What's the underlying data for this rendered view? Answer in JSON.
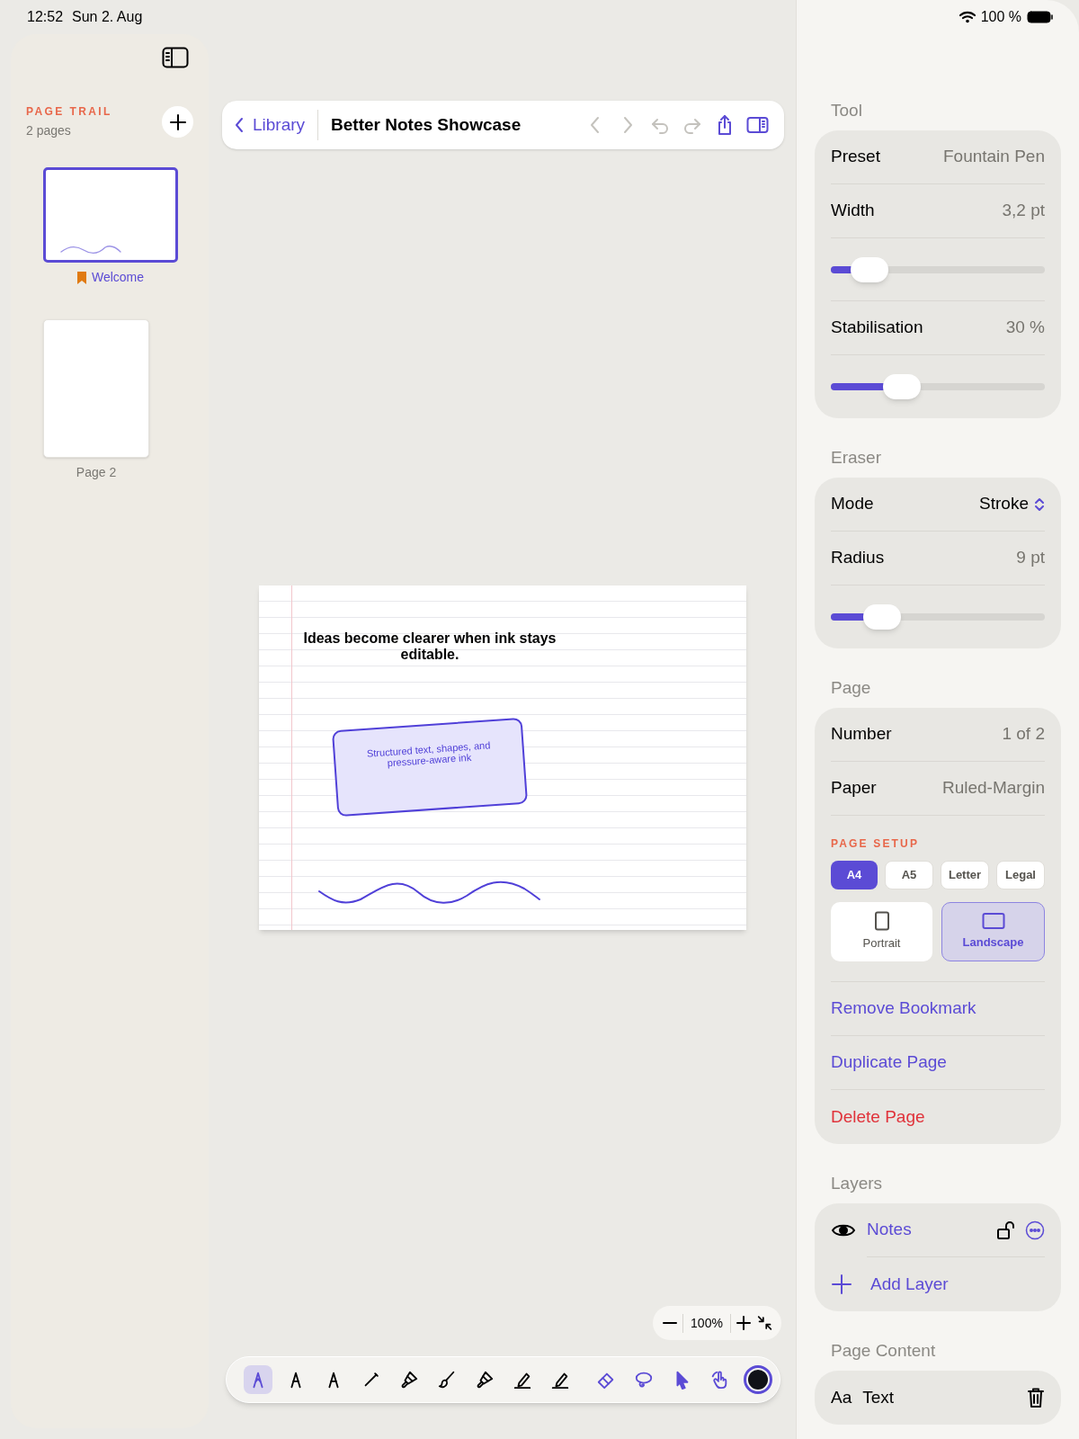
{
  "status_bar": {
    "time": "12:52",
    "date": "Sun 2. Aug",
    "battery": "100 %"
  },
  "sidebar": {
    "title": "PAGE TRAIL",
    "subtitle": "2 pages",
    "pages": [
      {
        "label": "Welcome",
        "selected": true,
        "bookmarked": true,
        "landscape": true
      },
      {
        "label": "Page 2",
        "selected": false,
        "bookmarked": false,
        "landscape": false
      }
    ]
  },
  "top_bar": {
    "back": "Library",
    "title": "Better Notes Showcase",
    "actions": [
      {
        "kind": "back",
        "disabled": true
      },
      {
        "kind": "forward",
        "disabled": true
      },
      {
        "kind": "undo",
        "disabled": true
      },
      {
        "kind": "redo",
        "disabled": true
      },
      {
        "kind": "share",
        "disabled": false
      },
      {
        "kind": "inspector",
        "disabled": false
      }
    ]
  },
  "canvas": {
    "heading": "Ideas become clearer when ink stays editable.",
    "shape_text": "Structured text, shapes, and pressure-aware ink"
  },
  "zoom": {
    "reading": "100%"
  },
  "tools": [
    {
      "kind": "fountain_pen",
      "selected": true
    },
    {
      "kind": "pen",
      "selected": false
    },
    {
      "kind": "pen",
      "selected": false
    },
    {
      "kind": "pencil",
      "selected": false
    },
    {
      "kind": "marker",
      "selected": false
    },
    {
      "kind": "brush",
      "selected": false
    },
    {
      "kind": "marker",
      "selected": false
    },
    {
      "kind": "highlighter",
      "selected": false
    },
    {
      "kind": "highlighter",
      "selected": false
    },
    {
      "kind": "eraser",
      "selected": false
    },
    {
      "kind": "lasso",
      "selected": false
    },
    {
      "kind": "pointer",
      "selected": false
    },
    {
      "kind": "hand",
      "selected": false
    }
  ],
  "ink": {
    "color": "#111118"
  },
  "inspector": [
    {
      "title": "Tool",
      "rows": [
        {
          "kind": "value",
          "label": "Preset",
          "value": "Fountain Pen"
        },
        {
          "kind": "value",
          "label": "Width",
          "value": "3,2 pt"
        },
        {
          "kind": "slider",
          "level": 0.18
        },
        {
          "kind": "value",
          "label": "Stabilisation",
          "value": "30 %"
        },
        {
          "kind": "slider",
          "level": 0.33
        }
      ]
    },
    {
      "title": "Eraser",
      "rows": [
        {
          "kind": "picker",
          "label": "Mode",
          "value": "Stroke"
        },
        {
          "kind": "value",
          "label": "Radius",
          "value": "9 pt"
        },
        {
          "kind": "slider",
          "level": 0.24
        }
      ]
    },
    {
      "title": "Page",
      "rows": [
        {
          "kind": "value",
          "label": "Number",
          "value": "1 of 2"
        },
        {
          "kind": "value",
          "label": "Paper",
          "value": "Ruled-Margin"
        },
        {
          "kind": "setup",
          "title": "PAGE SETUP",
          "sizes": [
            {
              "label": "A4",
              "selected": true
            },
            {
              "label": "A5",
              "selected": false
            },
            {
              "label": "Letter",
              "selected": false
            },
            {
              "label": "Legal",
              "selected": false
            }
          ],
          "orientations": [
            {
              "label": "Portrait",
              "selected": false
            },
            {
              "label": "Landscape",
              "selected": true
            }
          ]
        },
        {
          "kind": "action",
          "label": "Remove Bookmark",
          "destructive": false
        },
        {
          "kind": "action",
          "label": "Duplicate Page",
          "destructive": false
        },
        {
          "kind": "action",
          "label": "Delete Page",
          "destructive": true
        }
      ]
    },
    {
      "title": "Layers",
      "rows": [
        {
          "kind": "layer",
          "label": "Notes"
        },
        {
          "kind": "add",
          "label": "Add Layer"
        }
      ]
    },
    {
      "title": "Page Content",
      "rows": [
        {
          "kind": "content",
          "symbol": "Aa",
          "label": "Text"
        }
      ]
    }
  ]
}
